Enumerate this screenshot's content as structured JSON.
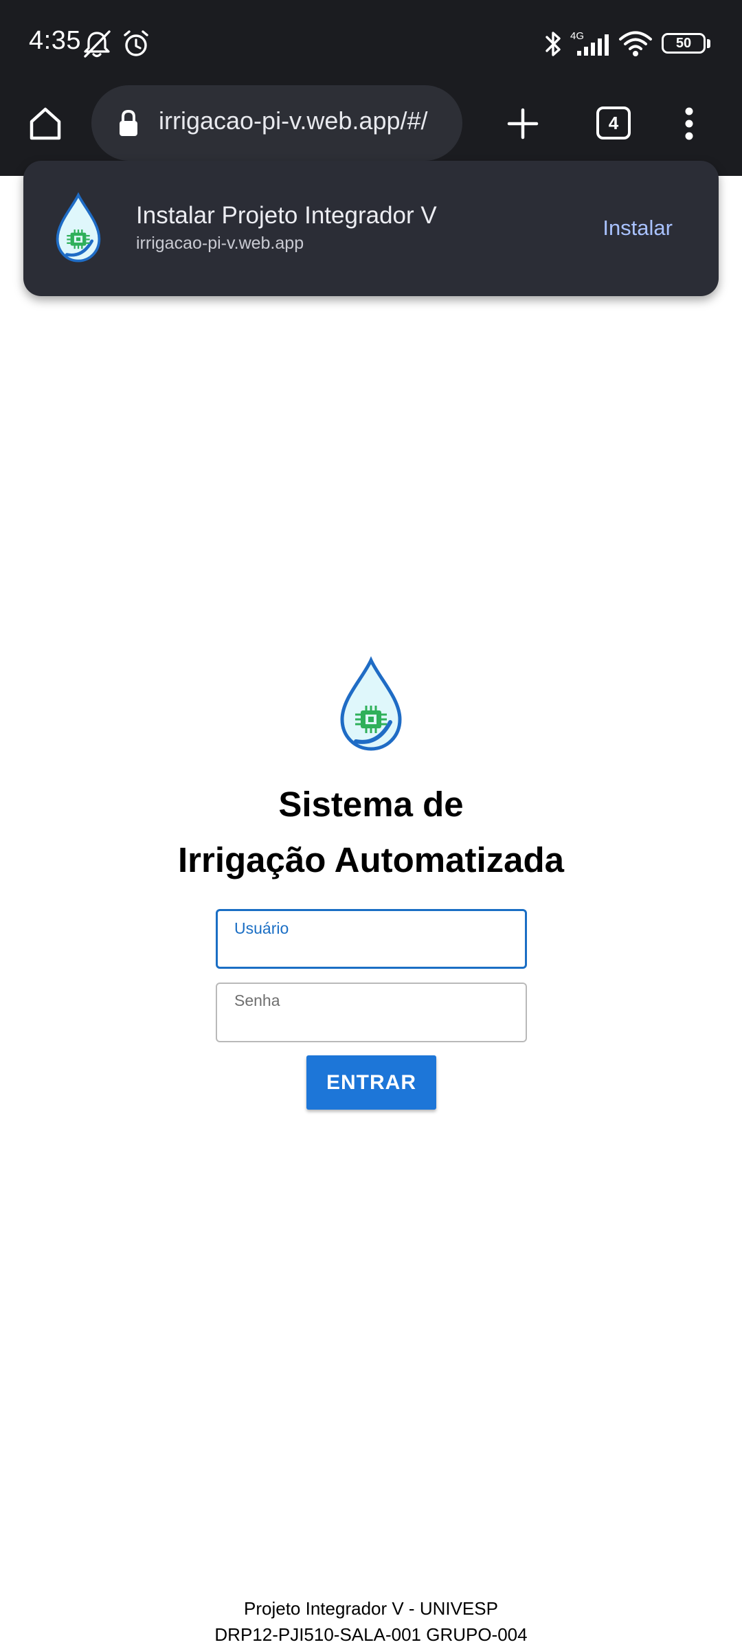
{
  "status_bar": {
    "time": "4:35",
    "network_label": "4G",
    "battery_percent": "50",
    "icons": [
      "notifications-muted-icon",
      "alarm-icon",
      "bluetooth-icon",
      "cellular-signal-icon",
      "wifi-icon",
      "battery-icon"
    ]
  },
  "browser": {
    "url": "irrigacao-pi-v.web.app/#/",
    "tab_count": "4",
    "icons": [
      "home-icon",
      "lock-icon",
      "new-tab-icon",
      "tabs-icon",
      "more-options-icon"
    ]
  },
  "install_banner": {
    "title": "Instalar Projeto Integrador V",
    "subtitle": "irrigacao-pi-v.web.app",
    "action_label": "Instalar",
    "accent_color": "#a9c2ff"
  },
  "login": {
    "title_line1": "Sistema de",
    "title_line2": "Irrigação Automatizada",
    "username_label": "Usuário",
    "username_value": "",
    "password_label": "Senha",
    "password_value": "",
    "submit_label": "ENTRAR",
    "primary_color": "#1d76d8"
  },
  "footer": {
    "line1": "Projeto Integrador V - UNIVESP",
    "line2": "DRP12-PJI510-SALA-001 GRUPO-004"
  }
}
